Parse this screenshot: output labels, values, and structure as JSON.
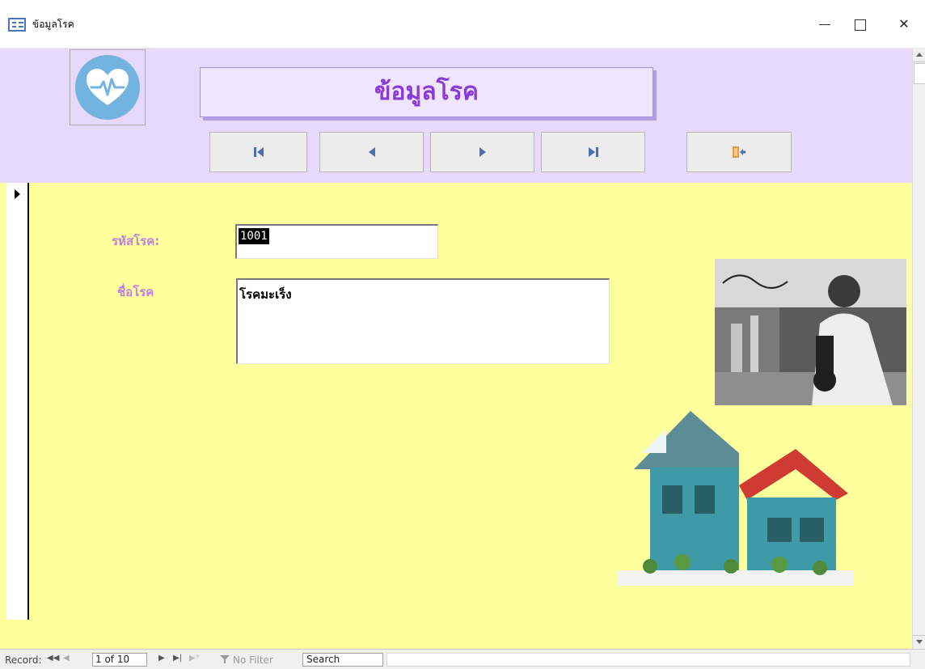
{
  "window": {
    "title": "ข้อมูลโรค",
    "minimize_icon": "minimize-icon",
    "maximize_icon": "maximize-icon",
    "close_glyph": "✕"
  },
  "header": {
    "title": "ข้อมูลโรค",
    "logo_icon": "heart-pulse-icon",
    "nav_buttons": {
      "first": "first-record-icon",
      "prev": "previous-record-icon",
      "next": "next-record-icon",
      "last": "last-record-icon",
      "exit": "exit-door-icon"
    }
  },
  "form": {
    "disease_code_label": "รหัสโรค:",
    "disease_code_value": "1001",
    "disease_name_label": "ชื่อโรค",
    "disease_name_value": "โรคมะเร็ง"
  },
  "record_nav": {
    "label": "Record:",
    "position": "1 of 10",
    "filter": "No Filter",
    "search": "Search"
  },
  "colors": {
    "header_bg": "#e7d9fc",
    "detail_bg": "#ffff9e",
    "title_text": "#8a3ad6",
    "label_text": "#c07fdc",
    "logo_circle": "#72b3df",
    "nav_icon": "#4a6fb0",
    "exit_icon": "#e89a3c"
  }
}
